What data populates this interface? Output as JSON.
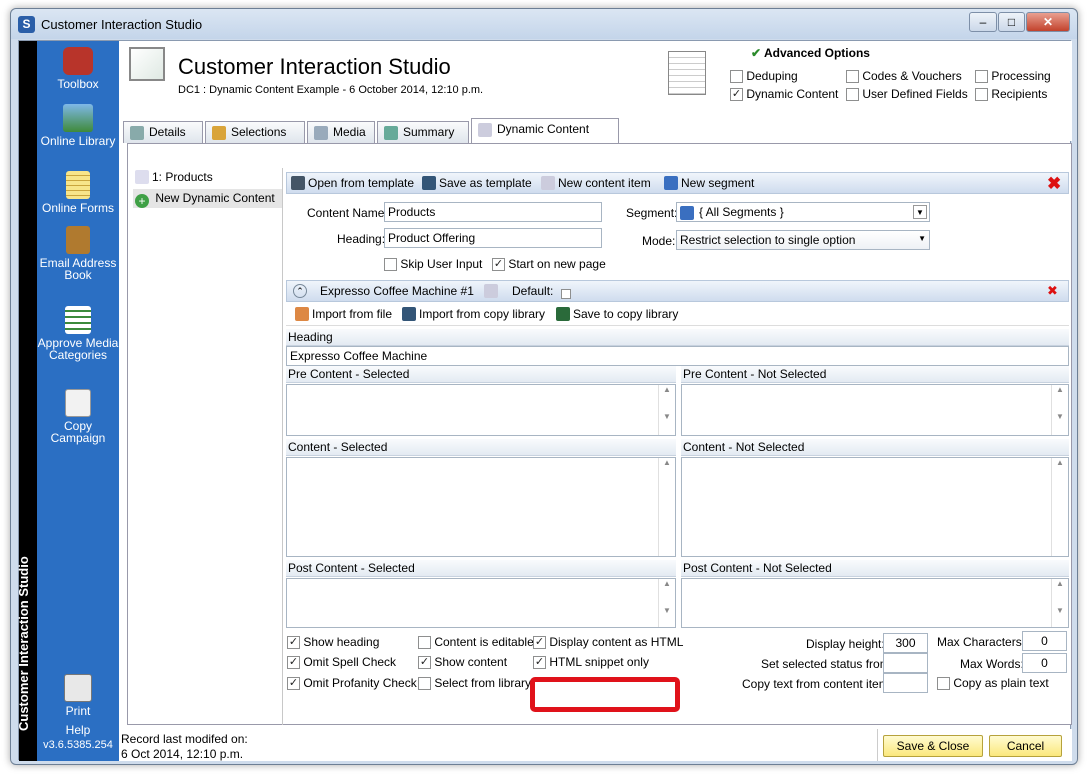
{
  "window": {
    "title": "Customer Interaction Studio",
    "app_icon": "S",
    "controls": {
      "minimize": "–",
      "maximize": "□",
      "close": "✕"
    }
  },
  "sidebar": {
    "vertical_title": "Customer Interaction Studio",
    "items": [
      {
        "label": "Toolbox",
        "icon": "toolbox-icon"
      },
      {
        "label": "Online Library",
        "icon": "library-icon"
      },
      {
        "label": "Online Forms",
        "icon": "forms-icon"
      },
      {
        "label": "Email Address Book",
        "icon": "address-book-icon"
      },
      {
        "label": "Approve Media Categories",
        "icon": "approve-icon"
      },
      {
        "label": "Copy Campaign",
        "icon": "copy-icon"
      },
      {
        "label": "Print",
        "icon": "print-icon"
      }
    ],
    "help": "Help",
    "version": "v3.6.5385.254"
  },
  "header": {
    "title": "Customer Interaction Studio",
    "subtitle": "DC1 : Dynamic Content Example - 6 October 2014, 12:10 p.m."
  },
  "advanced": {
    "title": "Advanced Options",
    "options": [
      {
        "label": "Deduping",
        "checked": false
      },
      {
        "label": "Codes & Vouchers",
        "checked": false
      },
      {
        "label": "Processing",
        "checked": false
      },
      {
        "label": "Dynamic Content",
        "checked": true
      },
      {
        "label": "User Defined Fields",
        "checked": false
      },
      {
        "label": "Recipients",
        "checked": false
      }
    ]
  },
  "tabs": [
    {
      "label": "Details"
    },
    {
      "label": "Selections"
    },
    {
      "label": "Media"
    },
    {
      "label": "Summary"
    },
    {
      "label": "Dynamic Content",
      "active": true
    }
  ],
  "tree": {
    "items": [
      "1: Products",
      "New Dynamic Content"
    ]
  },
  "toolbar": {
    "open_template": "Open from template",
    "save_template": "Save as template",
    "new_item": "New content item",
    "new_segment": "New segment"
  },
  "form": {
    "content_name_label": "Content Name:",
    "content_name": "Products",
    "heading_label": "Heading:",
    "heading": "Product Offering",
    "segment_label": "Segment:",
    "segment": "{ All Segments }",
    "mode_label": "Mode:",
    "mode": "Restrict selection to single option",
    "skip_user_input": "Skip User Input",
    "start_new_page": "Start on new page"
  },
  "item": {
    "title": "Expresso Coffee Machine #1",
    "default_label": "Default:",
    "import_file": "Import from file",
    "import_copy": "Import from copy library",
    "save_copy": "Save to copy library",
    "heading_label": "Heading",
    "heading_value": "Expresso Coffee Machine",
    "pre_sel": "Pre Content - Selected",
    "pre_not": "Pre Content - Not Selected",
    "content_sel": "Content - Selected",
    "content_not": "Content - Not Selected",
    "post_sel": "Post Content - Selected",
    "post_not": "Post Content - Not Selected"
  },
  "options": {
    "show_heading": "Show heading",
    "content_editable": "Content is editable",
    "display_html": "Display content as HTML",
    "omit_spell": "Omit Spell Check",
    "show_content": "Show content",
    "html_snippet": "HTML snippet only",
    "omit_profanity": "Omit Profanity Check",
    "select_library": "Select from library",
    "display_height_label": "Display height:",
    "display_height": "300",
    "max_chars_label": "Max Characters:",
    "max_chars": "0",
    "set_status_label": "Set selected status from",
    "max_words_label": "Max Words:",
    "max_words": "0",
    "copy_text_label": "Copy text from content item:",
    "copy_plain": "Copy as plain text"
  },
  "footer": {
    "record_label": "Record last modifed on:",
    "record_date": "6 Oct 2014, 12:10 p.m.",
    "save_close": "Save & Close",
    "cancel": "Cancel"
  },
  "colors": {
    "sidebar": "#2b6fc3",
    "highlight": "#e0121a",
    "button": "#fbe87d"
  }
}
